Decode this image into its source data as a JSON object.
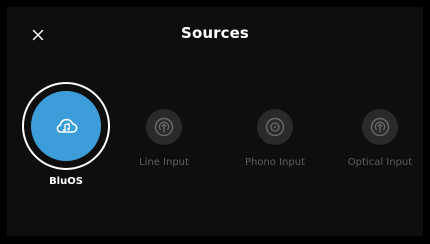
{
  "header": {
    "title": "Sources",
    "close_icon": "close-icon"
  },
  "sources": [
    {
      "label": "BluOS",
      "icon": "cloud-music-icon",
      "selected": true,
      "accent": "#3c9ed8"
    },
    {
      "label": "Line Input",
      "icon": "antenna-input-icon",
      "selected": false
    },
    {
      "label": "Phono Input",
      "icon": "vinyl-record-icon",
      "selected": false
    },
    {
      "label": "Optical Input",
      "icon": "optical-input-icon",
      "selected": false
    }
  ],
  "colors": {
    "background": "#0e0e0e",
    "accent": "#3c9ed8",
    "inactive_text": "#5e5e5e",
    "inactive_circle": "#2a2a2a"
  }
}
